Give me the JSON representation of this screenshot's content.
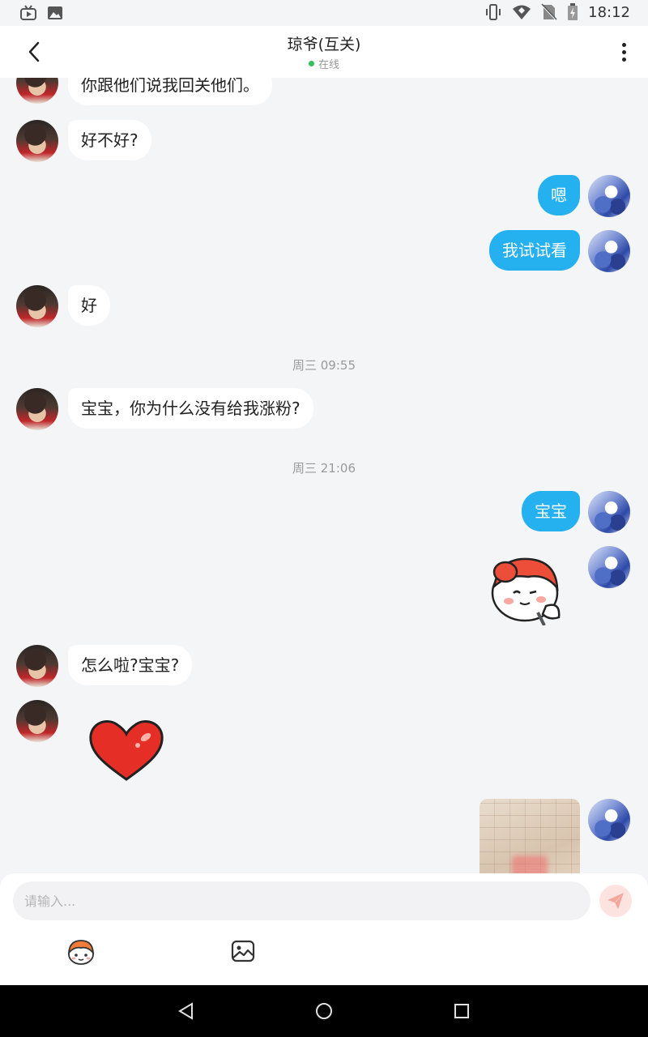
{
  "header": {
    "title": "琼爷(互关)",
    "status": "在线"
  },
  "status_bar": {
    "time": "18:12"
  },
  "messages": {
    "m1": "你跟他们说我回关他们。",
    "m2": "好不好?",
    "m3": "嗯",
    "m4": "我试试看",
    "m5": "好",
    "t1": "周三 09:55",
    "m6": "宝宝，你为什么没有给我涨粉?",
    "t2": "周三 21:06",
    "m7": "宝宝",
    "m8": "怎么啦?宝宝?"
  },
  "input": {
    "placeholder": "请输入..."
  },
  "colors": {
    "accent": "#25b0f0",
    "background": "#f4f5f7",
    "online": "#33c25a",
    "send_button_bg": "#fde3df"
  },
  "icons": {
    "back": "chevron-left-icon",
    "more": "more-vertical-icon",
    "send": "paper-plane-icon",
    "emoji": "sticker-face-icon",
    "image": "image-icon"
  }
}
